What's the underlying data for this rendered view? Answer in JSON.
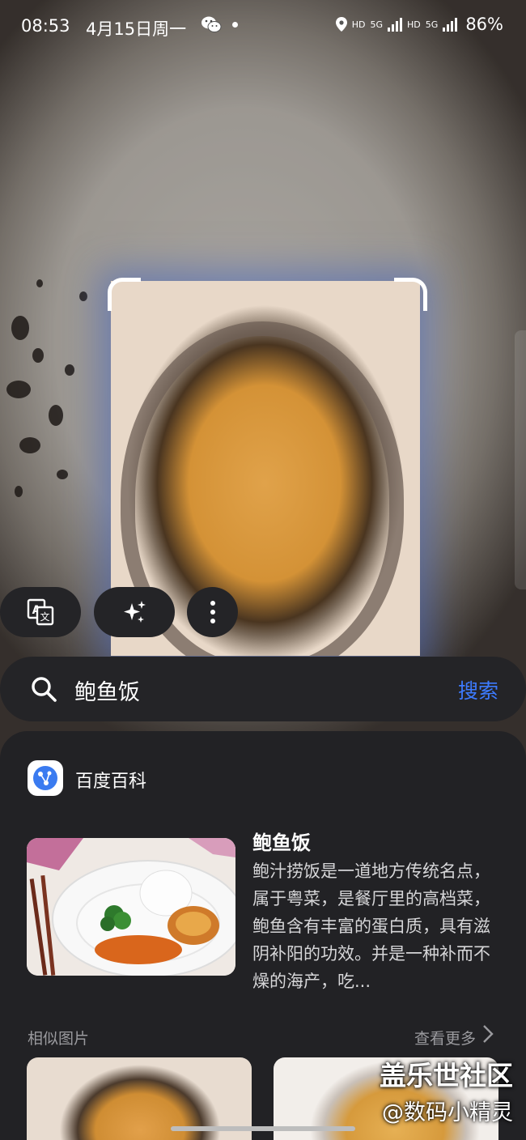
{
  "status_bar": {
    "time": "08:53",
    "date": "4月15日周一",
    "network_1": "HD",
    "network_2": "5G",
    "network_3": "HD",
    "network_4": "5G",
    "battery": "86%"
  },
  "actions": {
    "translate_icon": "translate-icon",
    "ai_icon": "sparkle-icon",
    "more_icon": "more-vertical-icon"
  },
  "search": {
    "query": "鲍鱼饭",
    "button_label": "搜索"
  },
  "result": {
    "source_name": "百度百科",
    "title": "鲍鱼饭",
    "description": "鲍汁捞饭是一道地方传统名点，属于粤菜，是餐厅里的高档菜，鲍鱼含有丰富的蛋白质，具有滋阴补阳的功效。并是一种补而不燥的海产，吃..."
  },
  "similar": {
    "label": "相似图片",
    "more_label": "查看更多"
  },
  "watermark": {
    "line1": "盖乐世社区",
    "line2": "@数码小精灵"
  },
  "colors": {
    "accent": "#3d7bff",
    "panel_bg": "#222225",
    "pill_bg": "#242427"
  }
}
